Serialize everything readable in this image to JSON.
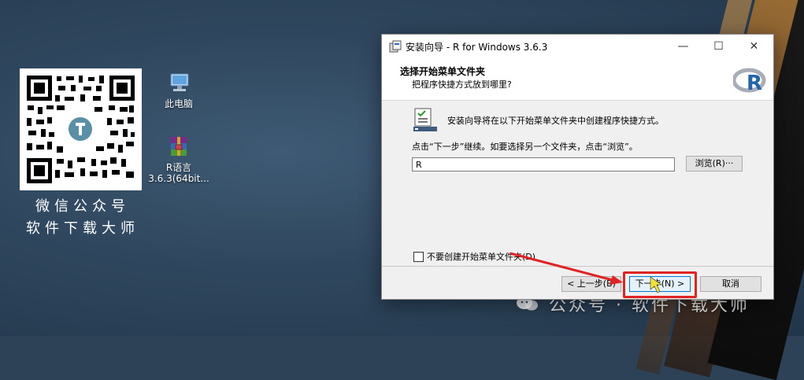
{
  "desktop": {
    "qr_caption_line1": "微信公众号",
    "qr_caption_line2": "软件下载大师",
    "icons": [
      {
        "label": "此电脑",
        "icon": "computer-icon"
      },
      {
        "label_line1": "R语言",
        "label_line2": "3.6.3(64bit...",
        "icon": "winrar-archive-icon"
      }
    ],
    "watermark": "公众号 · 软件下载大师"
  },
  "window": {
    "title": "安装向导 - R for Windows 3.6.3",
    "controls": {
      "minimize": "—",
      "maximize": "☐",
      "close": "✕"
    },
    "header": {
      "title": "选择开始菜单文件夹",
      "subtitle": "把程序快捷方式放到哪里?"
    },
    "body": {
      "intro": "安装向导将在以下开始菜单文件夹中创建程序快捷方式。",
      "hint": "点击“下一步”继续。如要选择另一个文件夹，点击“浏览”。",
      "folder_value": "R",
      "browse_label": "浏览(R)···",
      "no_folder_checkbox_label": "不要创建开始菜单文件夹(D)",
      "no_folder_checked": false
    },
    "footer": {
      "back_label": "< 上一步(B)",
      "next_label": "下一步(N) >",
      "cancel_label": "取消"
    }
  },
  "colors": {
    "highlight": "#e02424",
    "accent_button_border": "#0078d7"
  }
}
